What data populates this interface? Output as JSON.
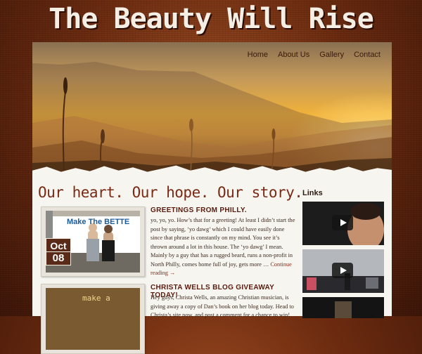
{
  "site": {
    "title": "The Beauty Will Rise"
  },
  "nav": {
    "items": [
      {
        "label": "Home"
      },
      {
        "label": "About Us"
      },
      {
        "label": "Gallery"
      },
      {
        "label": "Contact"
      }
    ]
  },
  "tagline": "Our heart. Our hope. Our story.",
  "posts": [
    {
      "title": "GREETINGS FROM PHILLY.",
      "date_month": "Oct",
      "date_day": "08",
      "photo_sign_text": "Make The BETTE",
      "excerpt": "yo, yo, yo. How’s that for a greeting! At least I didn’t start the post by saying, ‘yo dawg’ which I could have easily done since that phrase is constantly on my mind. You see it’s thrown around a lot in this house. The ‘yo dawg’ I mean. Mainly by a guy that has a rugged beard, runs a non-profit in North Philly, comes home full of joy, gets more …",
      "more_link": "Continue reading →"
    },
    {
      "title": "CHRISTA WELLS BLOG GIVEAWAY TODAY!",
      "photo_sign_text": "make a",
      "excerpt": "Hey guys, Christa Wells, an amazing Christian musician, is giving away a copy of Dan’s book on her blog today. Head to Christa’s site now, and post a comment for a chance to win!"
    }
  ],
  "sidebar": {
    "title": "Links"
  }
}
